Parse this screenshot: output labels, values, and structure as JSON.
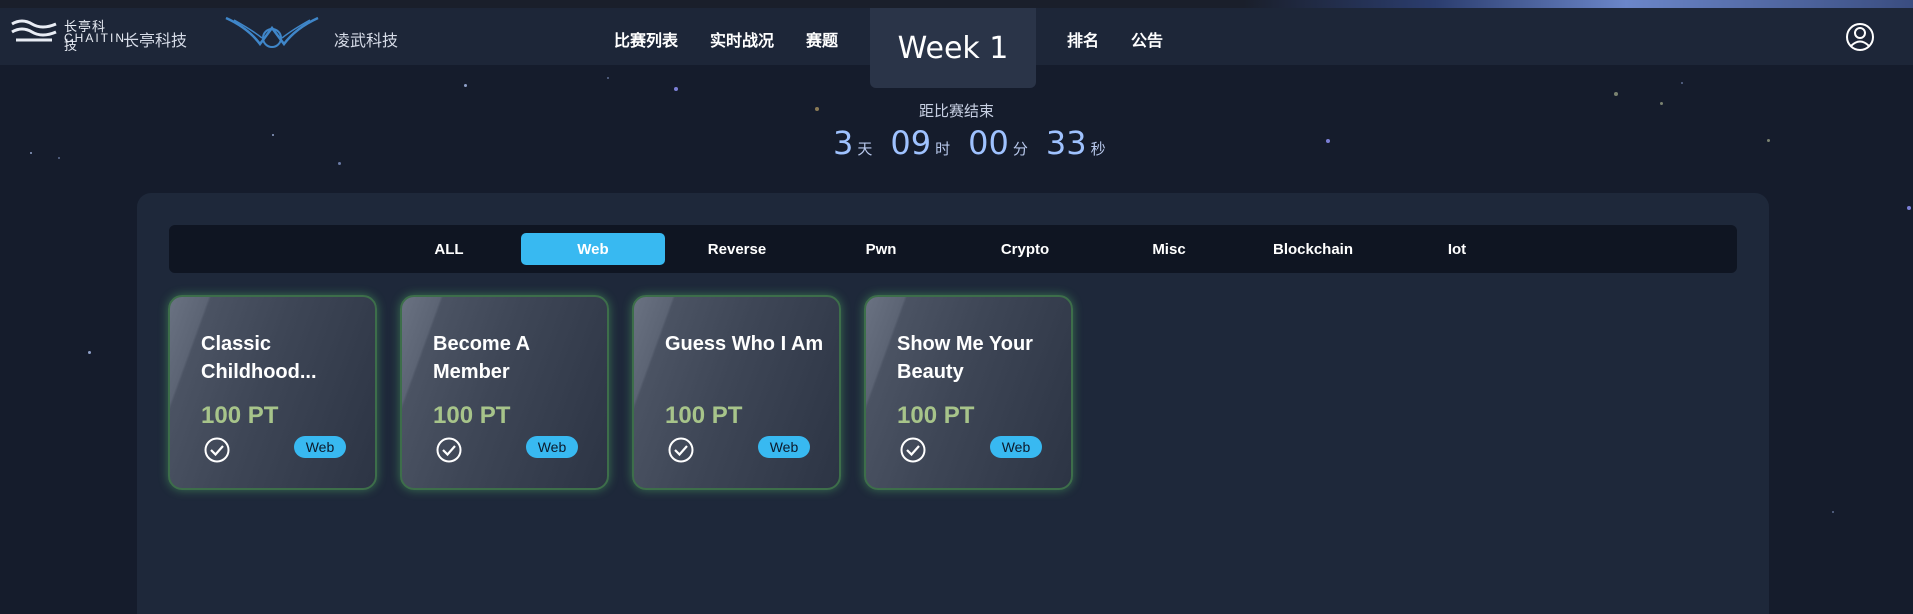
{
  "header": {
    "logo_cn": "长亭科技",
    "logo_en": "CHAITIN",
    "brand1": "长亭科技",
    "brand2": "凌武科技",
    "nav": [
      "比赛列表",
      "实时战况",
      "赛题",
      "排名",
      "公告"
    ],
    "week": "Week 1"
  },
  "countdown": {
    "label": "距比赛结束",
    "days": "3",
    "days_unit": "天",
    "hours": "09",
    "hours_unit": "时",
    "minutes": "00",
    "minutes_unit": "分",
    "seconds": "33",
    "seconds_unit": "秒"
  },
  "tabs": [
    "ALL",
    "Web",
    "Reverse",
    "Pwn",
    "Crypto",
    "Misc",
    "Blockchain",
    "Iot"
  ],
  "active_tab": "Web",
  "challenges": [
    {
      "title": "Classic Childhood...",
      "points": "100 PT",
      "tag": "Web",
      "solved": true
    },
    {
      "title": "Become A Member",
      "points": "100 PT",
      "tag": "Web",
      "solved": true
    },
    {
      "title": "Guess Who I Am",
      "points": "100 PT",
      "tag": "Web",
      "solved": true
    },
    {
      "title": "Show Me Your Beauty",
      "points": "100 PT",
      "tag": "Web",
      "solved": true
    }
  ],
  "colors": {
    "background": "#151c2c",
    "navbar": "#1d2638",
    "accent": "#38b9f1",
    "points": "#a7c48a",
    "card_glow": "#3d6e4a"
  },
  "icons": {
    "user": "user-circle-icon",
    "solved": "check-circle-icon"
  }
}
